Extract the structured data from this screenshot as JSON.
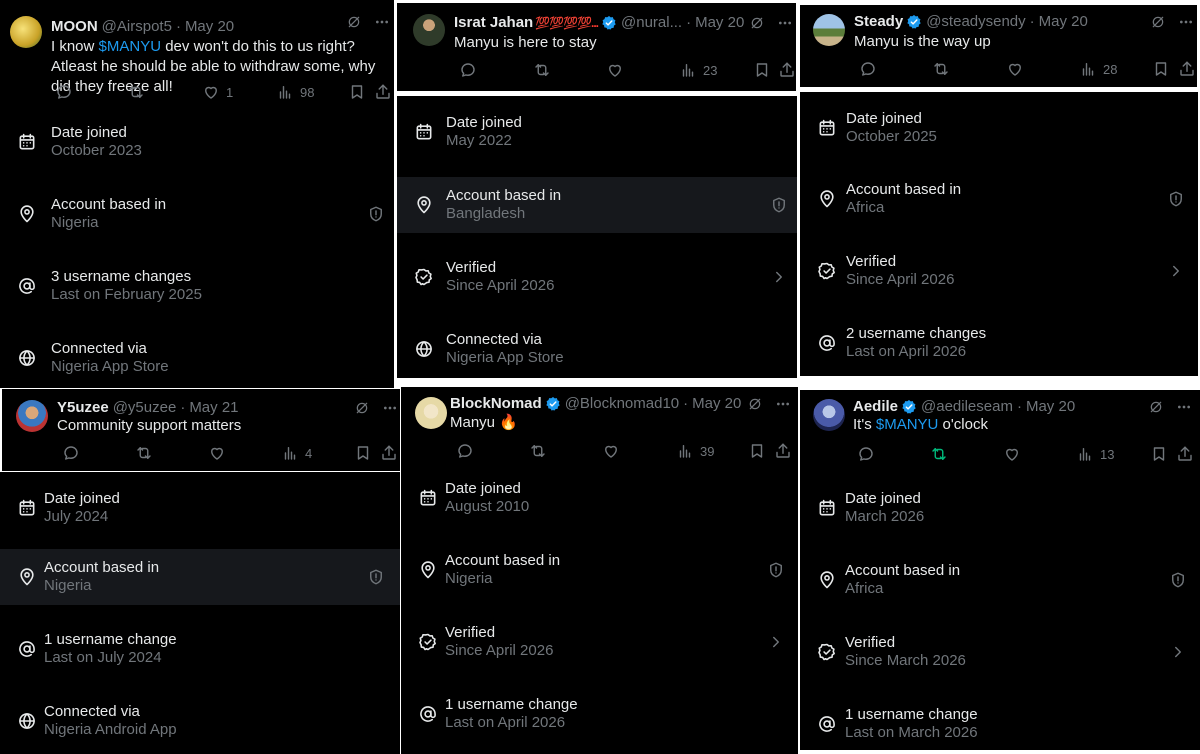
{
  "colors": {
    "background": "#000000",
    "text": "#e7e9ea",
    "muted": "#71767b",
    "link": "#1d9bf0",
    "verified": "#1d9bf0",
    "highlight": "#16181c"
  },
  "tweets": [
    {
      "name": "MOON",
      "handle": "@Airspot5",
      "date": "May 20",
      "verified": false,
      "text_before": "I know ",
      "cashtag": "$MANYU",
      "text_after": " dev won't do this to us right? Atleast he should be able to withdraw some, why did they freeze all!",
      "likes": "1",
      "views": "98"
    },
    {
      "name": "Israt Jahan",
      "name_emoji": "💯💯💯💯...",
      "handle": "@nural...",
      "date": "May 20",
      "verified": true,
      "text": "Manyu is here to stay",
      "views": "23"
    },
    {
      "name": "Steady",
      "handle": "@steadysendy",
      "date": "May 20",
      "verified": true,
      "text": "Manyu is the way up",
      "views": "28"
    },
    {
      "name": "Y5uzee",
      "handle": "@y5uzee",
      "date": "May 21",
      "verified": false,
      "text": "Community support matters",
      "views": "4"
    },
    {
      "name": "BlockNomad",
      "handle": "@Blocknomad10",
      "date": "May 20",
      "verified": true,
      "text": "Manyu 🔥",
      "views": "39"
    },
    {
      "name": "Aedile",
      "handle": "@aedileseam",
      "date": "May 20",
      "verified": true,
      "text_before": "It's ",
      "cashtag": "$MANYU",
      "text_after": " o'clock",
      "views": "13"
    }
  ],
  "panels": [
    {
      "rows": [
        {
          "icon": "calendar-icon",
          "label": "Date joined",
          "value": "October 2023"
        },
        {
          "icon": "location-icon",
          "label": "Account based in",
          "value": "Nigeria",
          "trail": "shield-icon"
        },
        {
          "icon": "at-icon",
          "label": "3 username changes",
          "value": "Last on February 2025"
        },
        {
          "icon": "globe-icon",
          "label": "Connected via",
          "value": "Nigeria App Store"
        }
      ]
    },
    {
      "rows": [
        {
          "icon": "calendar-icon",
          "label": "Date joined",
          "value": "May 2022"
        },
        {
          "icon": "location-icon",
          "label": "Account based in",
          "value": "Bangladesh",
          "trail": "shield-icon"
        },
        {
          "icon": "verified-check-icon",
          "label": "Verified",
          "value": "Since April 2026",
          "trail": "chevron-right-icon"
        },
        {
          "icon": "globe-icon",
          "label": "Connected via",
          "value": "Nigeria App Store"
        }
      ]
    },
    {
      "rows": [
        {
          "icon": "calendar-icon",
          "label": "Date joined",
          "value": "October 2025"
        },
        {
          "icon": "location-icon",
          "label": "Account based in",
          "value": "Africa",
          "trail": "shield-icon"
        },
        {
          "icon": "verified-check-icon",
          "label": "Verified",
          "value": "Since April 2026",
          "trail": "chevron-right-icon"
        },
        {
          "icon": "at-icon",
          "label": "2 username changes",
          "value": "Last on April 2026"
        }
      ]
    },
    {
      "rows": [
        {
          "icon": "calendar-icon",
          "label": "Date joined",
          "value": "July 2024"
        },
        {
          "icon": "location-icon",
          "label": "Account based in",
          "value": "Nigeria",
          "trail": "shield-icon"
        },
        {
          "icon": "at-icon",
          "label": "1 username change",
          "value": "Last on July 2024"
        },
        {
          "icon": "globe-icon",
          "label": "Connected via",
          "value": "Nigeria Android App"
        }
      ]
    },
    {
      "rows": [
        {
          "icon": "calendar-icon",
          "label": "Date joined",
          "value": "August 2010"
        },
        {
          "icon": "location-icon",
          "label": "Account based in",
          "value": "Nigeria",
          "trail": "shield-icon"
        },
        {
          "icon": "verified-check-icon",
          "label": "Verified",
          "value": "Since April 2026",
          "trail": "chevron-right-icon"
        },
        {
          "icon": "at-icon",
          "label": "1 username change",
          "value": "Last on April 2026"
        }
      ]
    },
    {
      "rows": [
        {
          "icon": "calendar-icon",
          "label": "Date joined",
          "value": "March 2026"
        },
        {
          "icon": "location-icon",
          "label": "Account based in",
          "value": "Africa",
          "trail": "shield-icon"
        },
        {
          "icon": "verified-check-icon",
          "label": "Verified",
          "value": "Since March 2026",
          "trail": "chevron-right-icon"
        },
        {
          "icon": "at-icon",
          "label": "1 username change",
          "value": "Last on March 2026"
        }
      ]
    }
  ]
}
